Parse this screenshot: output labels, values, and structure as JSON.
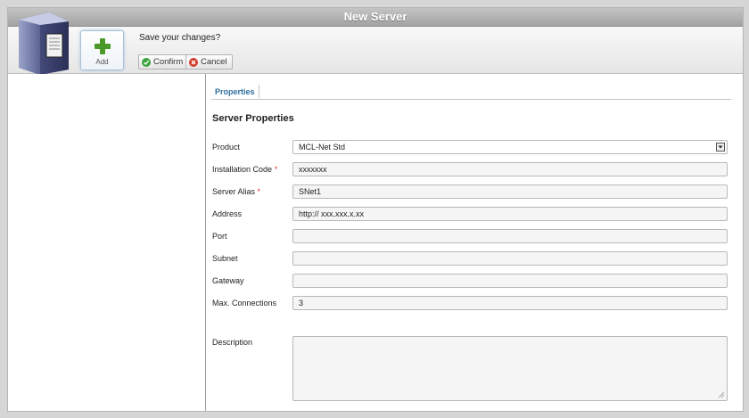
{
  "window": {
    "title": "New Server"
  },
  "toolbar": {
    "add_label": "Add",
    "prompt": "Save your changes?",
    "confirm_label": "Confirm",
    "cancel_label": "Cancel"
  },
  "tabs": [
    {
      "label": "Properties",
      "active": true
    }
  ],
  "section_title": "Server Properties",
  "form": {
    "product": {
      "label": "Product",
      "value": "MCL-Net Std",
      "required": false
    },
    "install_code": {
      "label": "Installation Code",
      "value": "xxxxxxx",
      "required": true
    },
    "server_alias": {
      "label": "Server Alias",
      "value": "SNet1",
      "required": true
    },
    "address": {
      "label": "Address",
      "value": "http:// xxx.xxx.x.xx",
      "required": false
    },
    "port": {
      "label": "Port",
      "value": "",
      "required": false
    },
    "subnet": {
      "label": "Subnet",
      "value": "",
      "required": false
    },
    "gateway": {
      "label": "Gateway",
      "value": "",
      "required": false
    },
    "max_connections": {
      "label": "Max. Connections",
      "value": "3",
      "required": false
    },
    "description": {
      "label": "Description",
      "value": "",
      "required": false
    },
    "required_marker": "*"
  },
  "icons": {
    "server": "server-icon",
    "add": "plus-icon",
    "confirm": "check-circle-icon",
    "cancel": "x-circle-icon",
    "dropdown": "dropdown-arrow-icon"
  },
  "colors": {
    "accent": "#2f6f9f",
    "required": "#e23b3b",
    "confirm": "#3ca23c",
    "cancel": "#d23a2a",
    "plus": "#4a9a2a"
  }
}
